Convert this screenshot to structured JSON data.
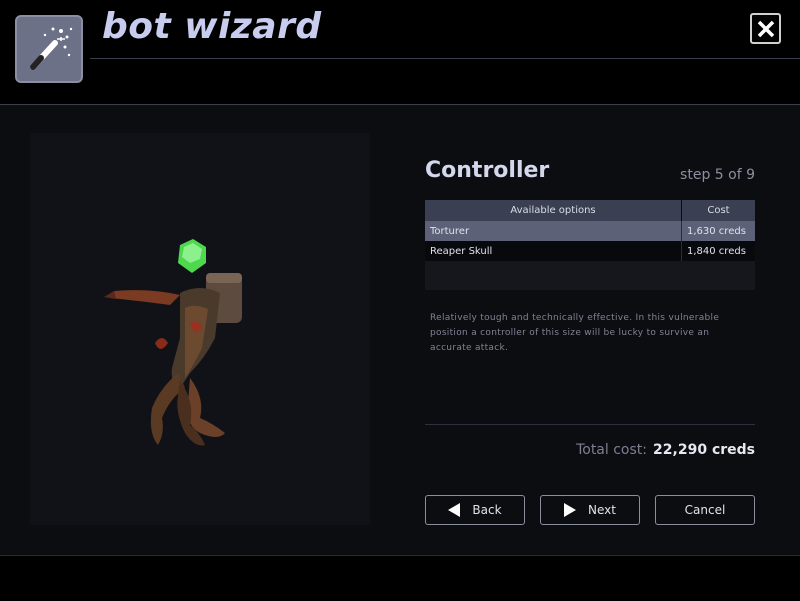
{
  "header": {
    "title": "bot wizard",
    "logo_icon": "magic-wand-icon",
    "close_icon": "close-icon"
  },
  "step": {
    "title": "Controller",
    "counter": "step 5 of 9"
  },
  "options_table": {
    "headers": [
      "Available options",
      "Cost"
    ],
    "rows": [
      {
        "name": "Torturer",
        "cost": "1,630 creds",
        "selected": true
      },
      {
        "name": "Reaper Skull",
        "cost": "1,840 creds",
        "selected": false
      }
    ]
  },
  "description": "Relatively tough and technically effective. In this vulnerable position a controller of this size will be lucky to survive an accurate attack.",
  "total": {
    "label": "Total cost:",
    "value": "22,290 creds"
  },
  "buttons": {
    "back": "Back",
    "next": "Next",
    "cancel": "Cancel"
  },
  "colors": {
    "accent": "#c8cdf0",
    "selected_row": "#5d6178",
    "header_row": "#3b3f52",
    "background": "#0c0d11"
  }
}
